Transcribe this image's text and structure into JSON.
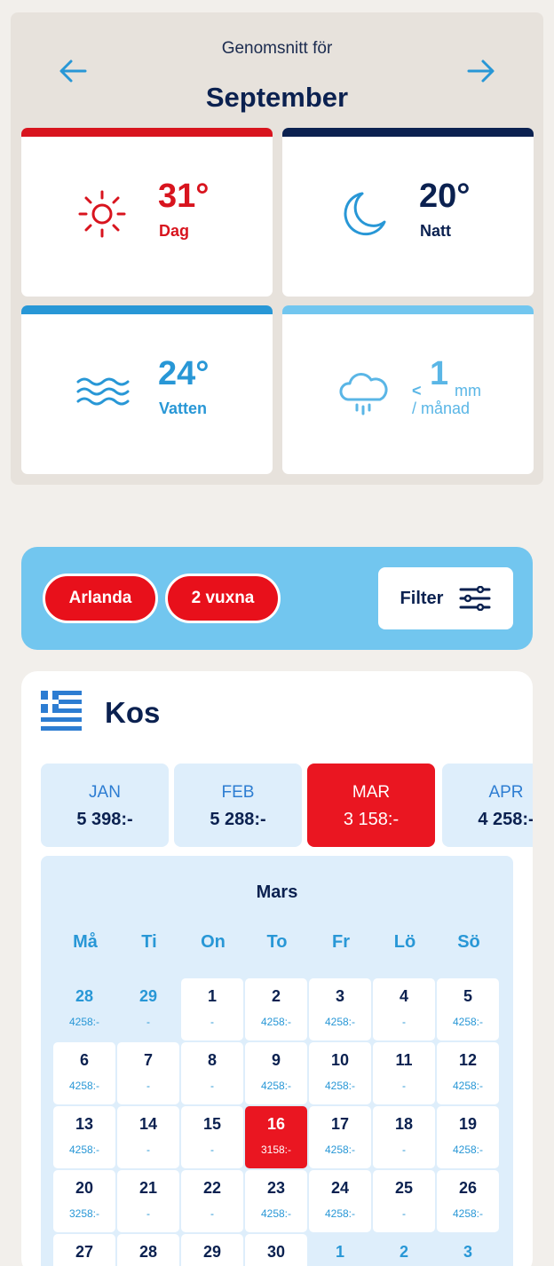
{
  "climate": {
    "subtitle": "Genomsnitt för",
    "month": "September",
    "day_temp": "31°",
    "day_label": "Dag",
    "night_temp": "20°",
    "night_label": "Natt",
    "water_temp": "24°",
    "water_label": "Vatten",
    "rain_prefix": "<",
    "rain_value": "1",
    "rain_unit": "mm",
    "rain_label": "/ månad",
    "colors": {
      "day": "#d8141e",
      "night": "#0b2150",
      "water": "#2897d6",
      "rain": "#72c6ef"
    }
  },
  "filters": {
    "chips": [
      "Arlanda",
      "2 vuxna"
    ],
    "filter_label": "Filter"
  },
  "destination": {
    "name": "Kos",
    "flag": "greece-flag-icon"
  },
  "months": [
    {
      "m": "JAN",
      "p": "5 398:-"
    },
    {
      "m": "FEB",
      "p": "5 288:-"
    },
    {
      "m": "MAR",
      "p": "3 158:-",
      "active": true
    },
    {
      "m": "APR",
      "p": "4 258:-"
    }
  ],
  "calendar": {
    "title": "Mars",
    "weekdays": [
      "Må",
      "Ti",
      "On",
      "To",
      "Fr",
      "Lö",
      "Sö"
    ],
    "weeks": [
      [
        {
          "n": "28",
          "p": "4258:-",
          "t": "out"
        },
        {
          "n": "29",
          "p": "-",
          "t": "out"
        },
        {
          "n": "1",
          "p": "-",
          "t": "in"
        },
        {
          "n": "2",
          "p": "4258:-",
          "t": "in"
        },
        {
          "n": "3",
          "p": "4258:-",
          "t": "in"
        },
        {
          "n": "4",
          "p": "-",
          "t": "in"
        },
        {
          "n": "5",
          "p": "4258:-",
          "t": "in"
        }
      ],
      [
        {
          "n": "6",
          "p": "4258:-",
          "t": "in"
        },
        {
          "n": "7",
          "p": "-",
          "t": "in"
        },
        {
          "n": "8",
          "p": "-",
          "t": "in"
        },
        {
          "n": "9",
          "p": "4258:-",
          "t": "in"
        },
        {
          "n": "10",
          "p": "4258:-",
          "t": "in"
        },
        {
          "n": "11",
          "p": "-",
          "t": "in"
        },
        {
          "n": "12",
          "p": "4258:-",
          "t": "in"
        }
      ],
      [
        {
          "n": "13",
          "p": "4258:-",
          "t": "in"
        },
        {
          "n": "14",
          "p": "-",
          "t": "in"
        },
        {
          "n": "15",
          "p": "-",
          "t": "in"
        },
        {
          "n": "16",
          "p": "3158:-",
          "t": "sel"
        },
        {
          "n": "17",
          "p": "4258:-",
          "t": "in"
        },
        {
          "n": "18",
          "p": "-",
          "t": "in"
        },
        {
          "n": "19",
          "p": "4258:-",
          "t": "in"
        }
      ],
      [
        {
          "n": "20",
          "p": "3258:-",
          "t": "in"
        },
        {
          "n": "21",
          "p": "-",
          "t": "in"
        },
        {
          "n": "22",
          "p": "-",
          "t": "in"
        },
        {
          "n": "23",
          "p": "4258:-",
          "t": "in"
        },
        {
          "n": "24",
          "p": "4258:-",
          "t": "in"
        },
        {
          "n": "25",
          "p": "-",
          "t": "in"
        },
        {
          "n": "26",
          "p": "4258:-",
          "t": "in"
        }
      ],
      [
        {
          "n": "27",
          "p": "",
          "t": "in"
        },
        {
          "n": "28",
          "p": "",
          "t": "in"
        },
        {
          "n": "29",
          "p": "",
          "t": "in"
        },
        {
          "n": "30",
          "p": "",
          "t": "in"
        },
        {
          "n": "1",
          "p": "",
          "t": "out"
        },
        {
          "n": "2",
          "p": "",
          "t": "out"
        },
        {
          "n": "3",
          "p": "",
          "t": "out"
        }
      ]
    ]
  }
}
